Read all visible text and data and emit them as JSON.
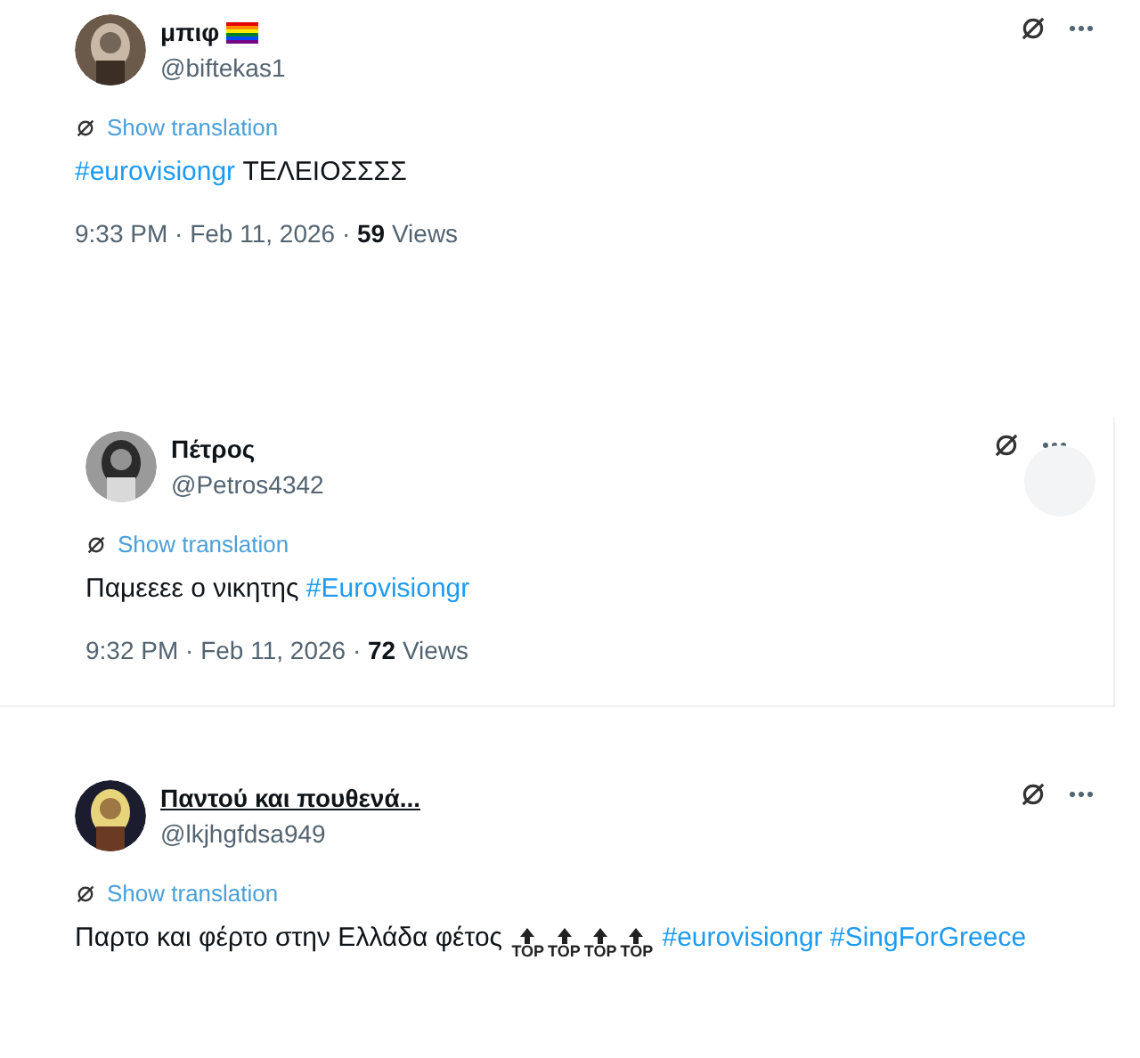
{
  "tweets": [
    {
      "name": "μπιφ",
      "flag": true,
      "name_hovered": false,
      "handle": "@biftekas1",
      "translate": "Show translation",
      "body": [
        {
          "kind": "hashtag",
          "text": "#eurovisiongr"
        },
        {
          "kind": "text",
          "text": " ΤΕΛΕΙΟΣΣΣΣ"
        }
      ],
      "time": "9:33 PM · Feb 11, 2026 · ",
      "views_count": "59",
      "views_label": " Views",
      "hover_circle": false,
      "framed": false
    },
    {
      "name": "Πέτρος",
      "flag": false,
      "name_hovered": false,
      "handle": "@Petros4342",
      "translate": "Show translation",
      "body": [
        {
          "kind": "text",
          "text": "Παμεεεε ο νικητης "
        },
        {
          "kind": "hashtag",
          "text": "#Eurovisiongr"
        }
      ],
      "time": "9:32 PM · Feb 11, 2026 · ",
      "views_count": "72",
      "views_label": " Views",
      "hover_circle": true,
      "framed": true
    },
    {
      "name": "Παντού και πουθενά...",
      "flag": false,
      "name_hovered": true,
      "handle": "@lkjhgfdsa949",
      "translate": "Show translation",
      "body": [
        {
          "kind": "text",
          "text": "Παρτο και φέρτο στην Ελλάδα φέτος "
        },
        {
          "kind": "emoji",
          "text": "TOP"
        },
        {
          "kind": "emoji",
          "text": "TOP"
        },
        {
          "kind": "emoji",
          "text": "TOP"
        },
        {
          "kind": "emoji",
          "text": "TOP"
        },
        {
          "kind": "hashtag",
          "text": "#eurovisiongr",
          "gap_before": true
        },
        {
          "kind": "hashtag",
          "text": "#SingForGreece",
          "gap_before": true
        }
      ],
      "hover_circle": false,
      "framed": false
    }
  ]
}
